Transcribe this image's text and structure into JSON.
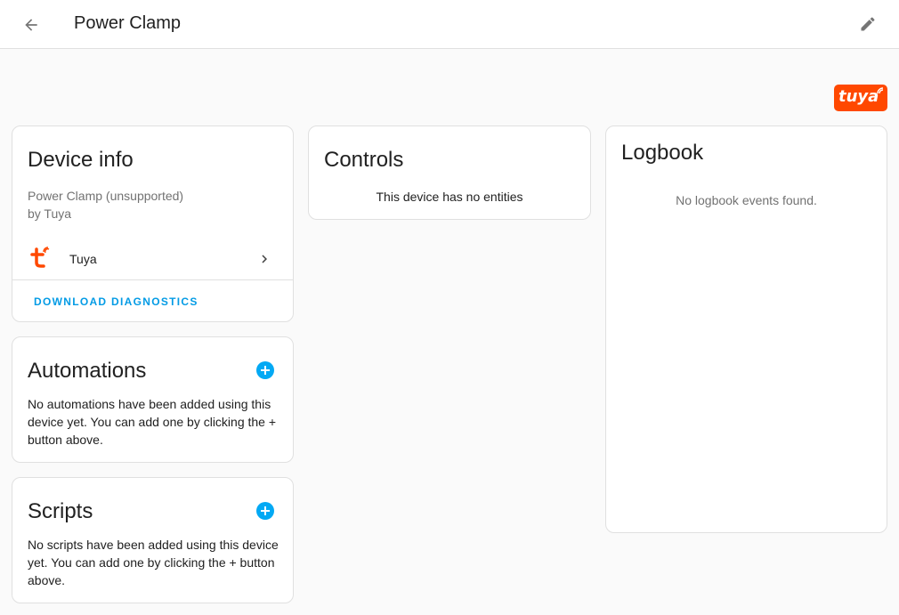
{
  "header": {
    "title": "Power Clamp",
    "back_icon": "arrow-left-icon",
    "edit_icon": "pencil-icon"
  },
  "brand": {
    "logo_text": "tuya",
    "color": "#ff4800"
  },
  "device_info": {
    "title": "Device info",
    "model": "Power Clamp (unsupported)",
    "manufacturer": "by Tuya",
    "integration_label": "Tuya",
    "integration_icon": "tuya-icon",
    "download_label": "DOWNLOAD DIAGNOSTICS"
  },
  "automations": {
    "title": "Automations",
    "empty_text": "No automations have been added using this device yet. You can add one by clicking the + button above."
  },
  "scripts": {
    "title": "Scripts",
    "empty_text": "No scripts have been added using this device yet. You can add one by clicking the + button above."
  },
  "controls": {
    "title": "Controls",
    "empty_text": "This device has no entities"
  },
  "logbook": {
    "title": "Logbook",
    "empty_text": "No logbook events found."
  },
  "colors": {
    "accent": "#03a9f4",
    "link": "#039be5",
    "brand": "#ff4800"
  }
}
